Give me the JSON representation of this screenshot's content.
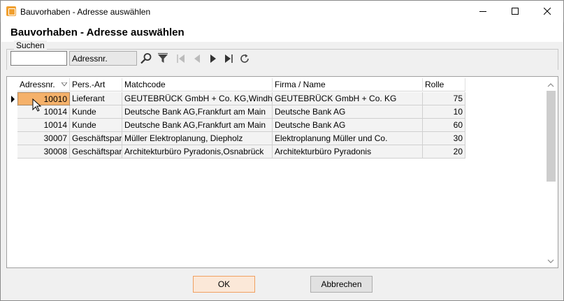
{
  "window": {
    "title": "Bauvorhaben - Adresse auswählen"
  },
  "header": {
    "title": "Bauvorhaben - Adresse auswählen"
  },
  "search": {
    "group_label": "Suchen",
    "input_value": "",
    "field_selected": "Adressnr."
  },
  "toolbar": {
    "icons": [
      "search-icon",
      "filter-icon",
      "first-record-icon",
      "previous-record-icon",
      "next-record-icon",
      "last-record-icon",
      "refresh-icon"
    ]
  },
  "table": {
    "columns": [
      "Adressnr.",
      "Pers.-Art",
      "Matchcode",
      "Firma / Name",
      "Rolle"
    ],
    "rows": [
      {
        "adressnr": "10010",
        "persart": "Lieferant",
        "matchcode": "GEUTEBRÜCK GmbH + Co. KG,Windhagen",
        "firma": "GEUTEBRÜCK GmbH + Co. KG",
        "rolle": "75"
      },
      {
        "adressnr": "10014",
        "persart": "Kunde",
        "matchcode": "Deutsche Bank AG,Frankfurt am Main",
        "firma": "Deutsche Bank AG",
        "rolle": "10"
      },
      {
        "adressnr": "10014",
        "persart": "Kunde",
        "matchcode": "Deutsche Bank AG,Frankfurt am Main",
        "firma": "Deutsche Bank AG",
        "rolle": "60"
      },
      {
        "adressnr": "30007",
        "persart": "Geschäftspartner",
        "matchcode": "Müller Elektroplanung, Diepholz",
        "firma": "Elektroplanung Müller und Co.",
        "rolle": "30"
      },
      {
        "adressnr": "30008",
        "persart": "Geschäftspartner",
        "matchcode": "Architekturbüro Pyradonis,Osnabrück",
        "firma": "Architekturbüro Pyradonis",
        "rolle": "20"
      }
    ],
    "selected_row": 0
  },
  "buttons": {
    "ok": "OK",
    "cancel": "Abbrechen"
  },
  "colors": {
    "active_cell": "#f5b16a",
    "ok_button_border": "#f0a060"
  }
}
